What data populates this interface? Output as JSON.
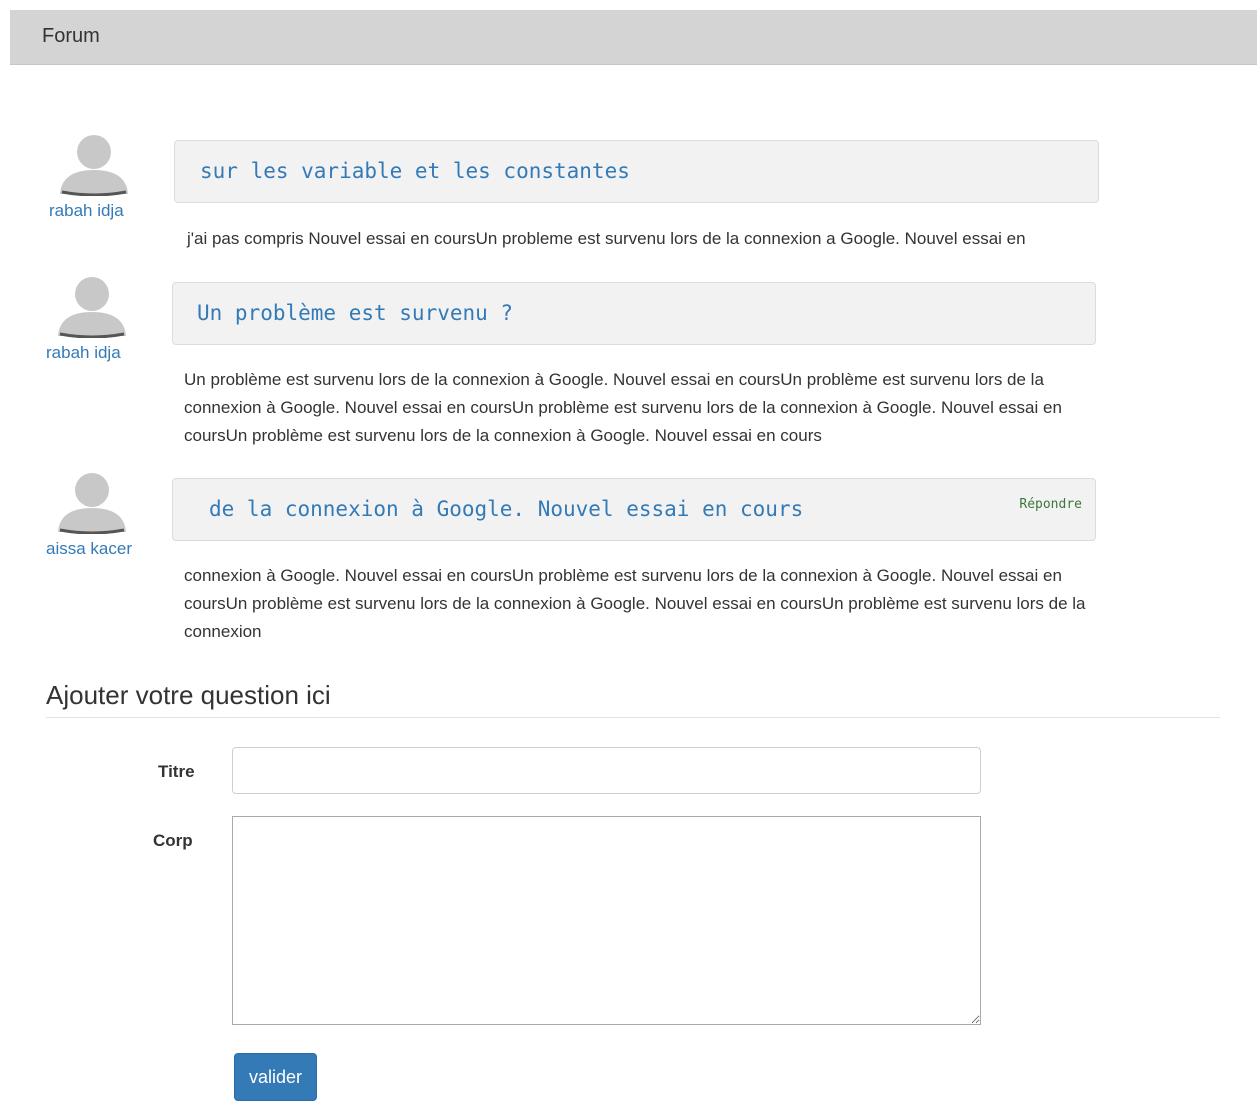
{
  "header": {
    "title": "Forum"
  },
  "posts": [
    {
      "author": "rabah idja",
      "title": "sur les variable et les constantes",
      "body": "j'ai pas compris Nouvel essai en coursUn probleme est survenu lors de la connexion a Google. Nouvel essai en",
      "reply_label": ""
    },
    {
      "author": "rabah idja",
      "title": "Un problème est survenu ?",
      "body": "Un problème est survenu lors de la connexion à Google. Nouvel essai en coursUn problème est survenu lors de la connexion à Google. Nouvel essai en coursUn problème est survenu lors de la connexion à Google. Nouvel essai en coursUn problème est survenu lors de la connexion à Google. Nouvel essai en cours",
      "reply_label": ""
    },
    {
      "author": "aissa kacer",
      "title": "de la connexion à Google. Nouvel essai en cours",
      "body": "connexion à Google. Nouvel essai en coursUn problème est survenu lors de la connexion à Google. Nouvel essai en coursUn problème est survenu lors de la connexion à Google. Nouvel essai en coursUn problème est survenu lors de la connexion",
      "reply_label": "Répondre"
    }
  ],
  "form": {
    "heading": "Ajouter votre question ici",
    "title_label": "Titre",
    "title_value": "",
    "body_label": "Corp",
    "body_value": "",
    "submit_label": "valider"
  }
}
